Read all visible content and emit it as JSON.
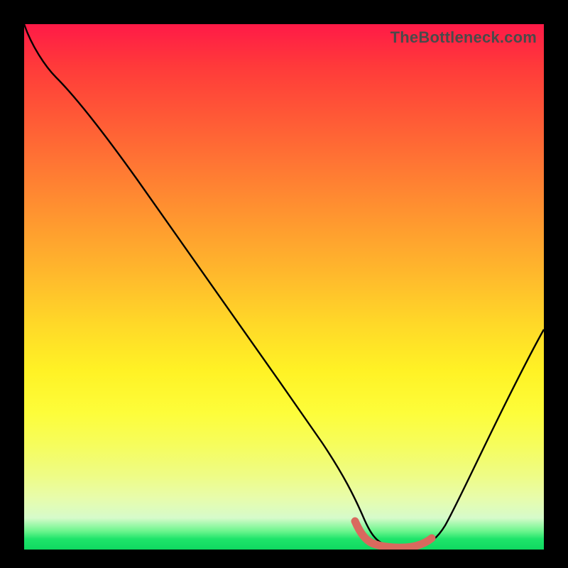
{
  "watermark": "TheBottleneck.com",
  "colors": {
    "background": "#000000",
    "curve": "#000000",
    "marker": "#d9695e",
    "gradient_top": "#ff1a47",
    "gradient_bottom": "#10d860"
  },
  "chart_data": {
    "type": "line",
    "title": "",
    "xlabel": "",
    "ylabel": "",
    "xlim": [
      0,
      100
    ],
    "ylim": [
      0,
      100
    ],
    "grid": false,
    "legend_position": "none",
    "series": [
      {
        "name": "bottleneck-curve",
        "x": [
          0,
          6,
          12,
          20,
          30,
          40,
          50,
          60,
          63,
          65,
          70,
          75,
          78,
          80,
          85,
          92,
          100
        ],
        "values": [
          100,
          96,
          90,
          81,
          68,
          55,
          42,
          27,
          18,
          10,
          3,
          1,
          1,
          2,
          7,
          19,
          40
        ]
      }
    ],
    "highlight_range": {
      "x_start": 63,
      "x_end": 78,
      "y": 1
    },
    "annotations": []
  }
}
